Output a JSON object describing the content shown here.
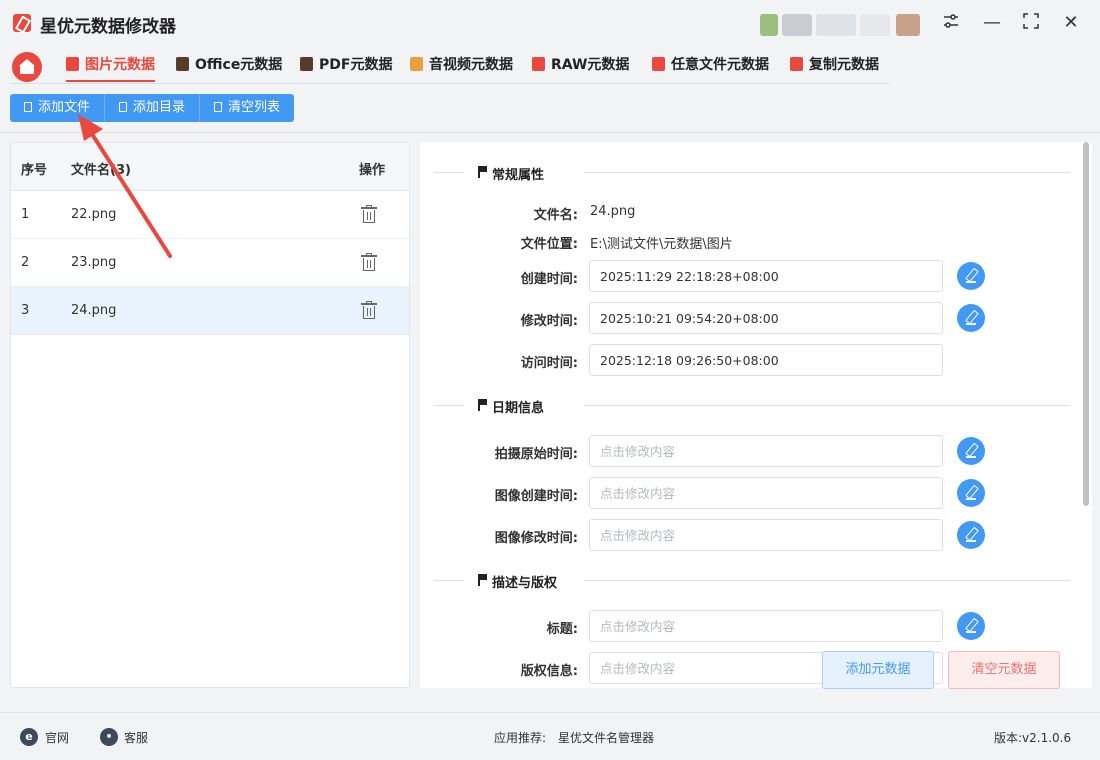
{
  "app": {
    "title": "星优元数据修改器"
  },
  "window_controls": {
    "settings_icon": "sliders-icon",
    "min_glyph": "—",
    "max_glyph": "⛶",
    "close_glyph": "✕"
  },
  "tabs": [
    {
      "label": "图片元数据",
      "icon": "image-icon",
      "color": "#e8483d",
      "active": true
    },
    {
      "label": "Office元数据",
      "icon": "office-icon",
      "color": "#5a3b2a",
      "active": false
    },
    {
      "label": "PDF元数据",
      "icon": "pdf-icon",
      "color": "#5a3b2a",
      "active": false
    },
    {
      "label": "音视频元数据",
      "icon": "media-icon",
      "color": "#e8a13d",
      "active": false
    },
    {
      "label": "RAW元数据",
      "icon": "raw-icon",
      "color": "#e8483d",
      "active": false
    },
    {
      "label": "任意文件元数据",
      "icon": "file-icon",
      "color": "#e8483d",
      "active": false
    },
    {
      "label": "复制元数据",
      "icon": "copy-icon",
      "color": "#e8483d",
      "active": false
    }
  ],
  "toolbar": {
    "add_file": "添加文件",
    "add_dir": "添加目录",
    "clear_list": "清空列表"
  },
  "file_list": {
    "headers": {
      "index": "序号",
      "name": "文件名(3)",
      "action": "操作"
    },
    "rows": [
      {
        "index": "1",
        "name": "22.png",
        "selected": false
      },
      {
        "index": "2",
        "name": "23.png",
        "selected": false
      },
      {
        "index": "3",
        "name": "24.png",
        "selected": true
      }
    ]
  },
  "sections": {
    "general": "常规属性",
    "date": "日期信息",
    "desc": "描述与版权"
  },
  "fields": {
    "filename": {
      "label": "文件名:",
      "value": "24.png"
    },
    "location": {
      "label": "文件位置:",
      "value": "E:\\测试文件\\元数据\\图片"
    },
    "created": {
      "label": "创建时间:",
      "value": "2025:11:29 22:18:28+08:00"
    },
    "modified": {
      "label": "修改时间:",
      "value": "2025:10:21 09:54:20+08:00"
    },
    "accessed": {
      "label": "访问时间:",
      "value": "2025:12:18 09:26:50+08:00"
    },
    "shot_time": {
      "label": "拍摄原始时间:",
      "placeholder": "点击修改内容"
    },
    "img_created": {
      "label": "图像创建时间:",
      "placeholder": "点击修改内容"
    },
    "img_modified": {
      "label": "图像修改时间:",
      "placeholder": "点击修改内容"
    },
    "title": {
      "label": "标题:",
      "placeholder": "点击修改内容"
    },
    "copyright": {
      "label": "版权信息:",
      "placeholder": "点击修改内容"
    }
  },
  "actions": {
    "add_meta": "添加元数据",
    "clear_meta": "清空元数据"
  },
  "footer": {
    "website": "官网",
    "support": "客服",
    "recommend_label": "应用推荐:",
    "recommend_app": "星优文件名管理器",
    "version": "版本:v2.1.0.6"
  },
  "colors": {
    "accent": "#4199f3",
    "brand": "#e8483d",
    "annotation_arrow": "#e8483d"
  }
}
